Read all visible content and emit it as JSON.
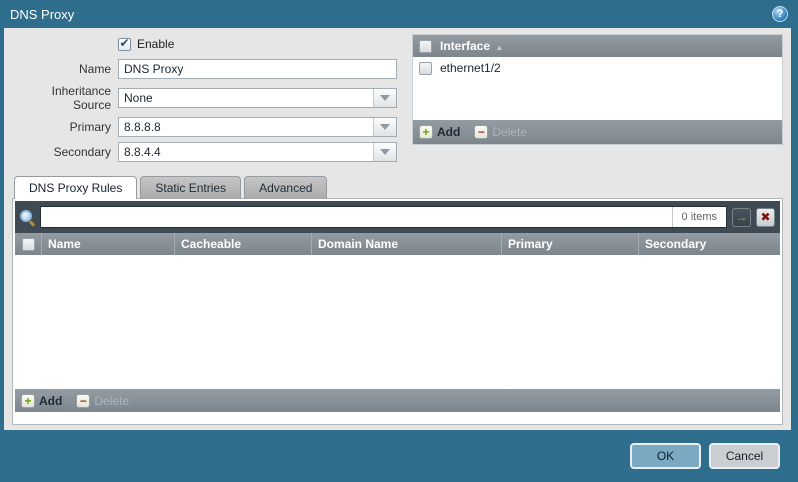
{
  "window": {
    "title": "DNS Proxy"
  },
  "icons": {
    "help": "?",
    "apply_filter": "→",
    "clear_filter": "✖",
    "add": "+",
    "delete": "−",
    "sort_asc": "▲"
  },
  "form": {
    "enable_label": "Enable",
    "enable_checked": true,
    "fields": [
      {
        "label": "Name",
        "value": "DNS Proxy",
        "dropdown": false
      },
      {
        "label": "Inheritance Source",
        "value": "None",
        "dropdown": true
      },
      {
        "label": "Primary",
        "value": "8.8.8.8",
        "dropdown": true
      },
      {
        "label": "Secondary",
        "value": "8.8.4.4",
        "dropdown": true
      }
    ]
  },
  "interface_panel": {
    "column": "Interface",
    "rows": [
      {
        "label": "ethernet1/2",
        "checked": false
      }
    ],
    "add_label": "Add",
    "delete_label": "Delete",
    "delete_enabled": false
  },
  "tabs": [
    {
      "label": "DNS Proxy Rules",
      "active": true
    },
    {
      "label": "Static Entries",
      "active": false
    },
    {
      "label": "Advanced",
      "active": false
    }
  ],
  "rules_panel": {
    "search_value": "",
    "items_count": "0 items",
    "columns": [
      "Name",
      "Cacheable",
      "Domain Name",
      "Primary",
      "Secondary"
    ],
    "rows": [],
    "add_label": "Add",
    "delete_label": "Delete",
    "delete_enabled": false
  },
  "footer": {
    "ok_label": "OK",
    "cancel_label": "Cancel"
  },
  "colors": {
    "titlebar": "#2e6d8b",
    "content_bg": "#e6e6e6",
    "header_gray": "#868f97",
    "search_strip": "#3e4a54",
    "ok_button": "#7ca9c2",
    "cancel_button": "#cbced1",
    "add_green": "#6da012",
    "delete_red": "#9b3a2a"
  }
}
